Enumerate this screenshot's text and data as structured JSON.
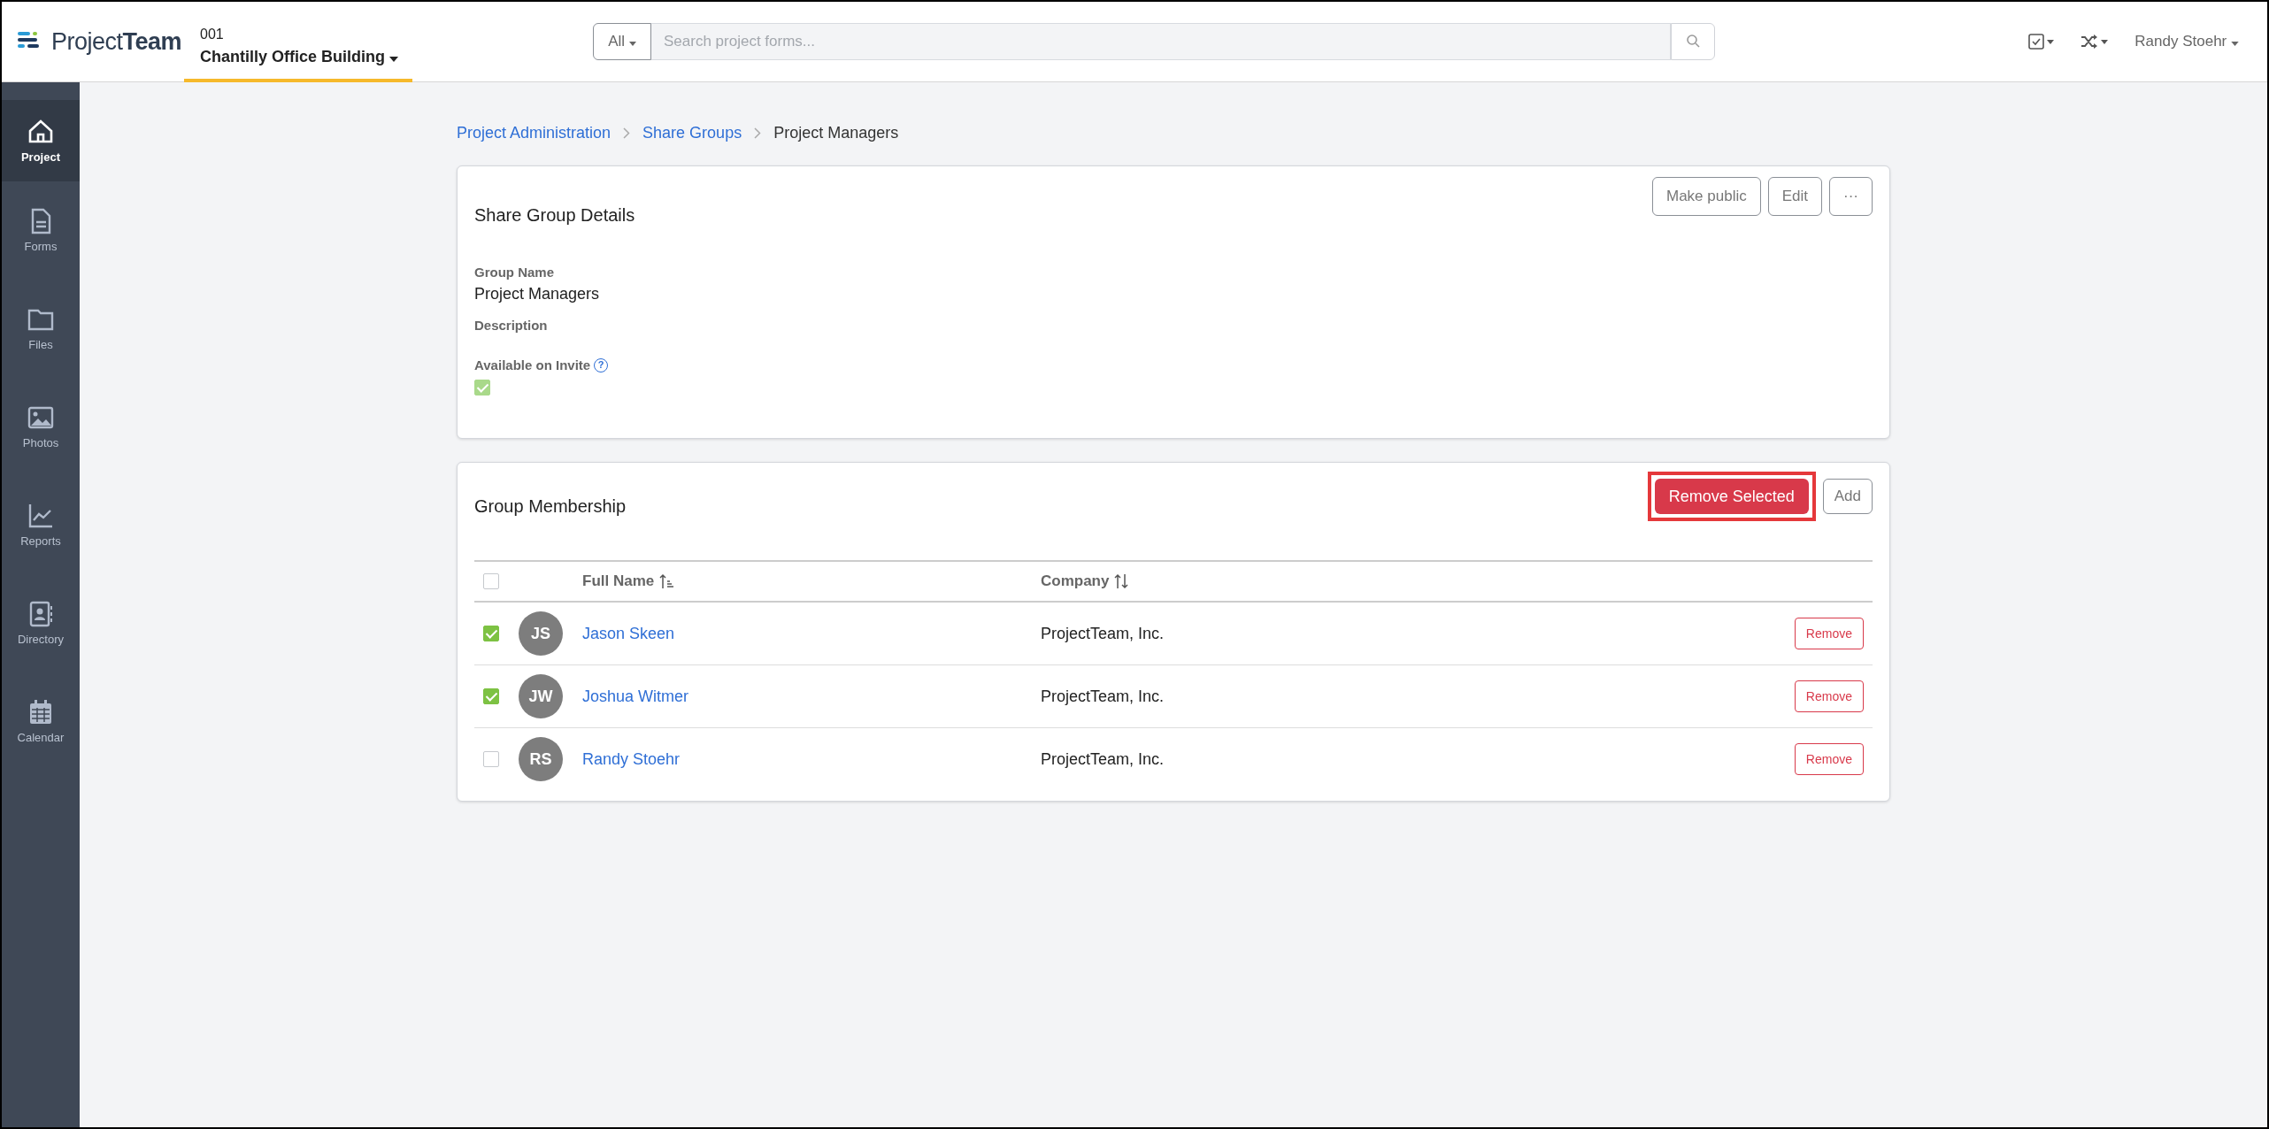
{
  "header": {
    "logo": "Project**Team**",
    "project": {
      "number": "001",
      "name": "Chantilly Office Building"
    },
    "search": {
      "scope": "All",
      "placeholder": "Search project forms..."
    },
    "user": "Randy Stoehr"
  },
  "sidebar": {
    "items": [
      {
        "label": "Project",
        "selected": true
      },
      {
        "label": "Forms",
        "selected": false
      },
      {
        "label": "Files",
        "selected": false
      },
      {
        "label": "Photos",
        "selected": false
      },
      {
        "label": "Reports",
        "selected": false
      },
      {
        "label": "Directory",
        "selected": false
      },
      {
        "label": "Calendar",
        "selected": false
      }
    ]
  },
  "breadcrumb": [
    {
      "label": "Project Administration",
      "current": false
    },
    {
      "label": "Share Groups",
      "current": false
    },
    {
      "label": "Project Managers",
      "current": true
    }
  ],
  "details": {
    "title": "Share Group Details",
    "buttons": [
      "Make public",
      "Edit",
      "···"
    ],
    "fields": [
      {
        "label": "Group Name",
        "value": "Project Managers"
      },
      {
        "label": "Description"
      }
    ],
    "available": {
      "label": "Available on Invite",
      "help": "?",
      "checked": true
    }
  },
  "membership": {
    "title": "Group Membership",
    "remove_selected": {
      "label": "Remove Selected",
      "highlighted": true
    },
    "add": "Add",
    "select_all": {
      "checked": false
    },
    "columns": [
      "Full Name",
      "Company"
    ],
    "rows": [
      {
        "initials": "JS",
        "name": "Jason Skeen",
        "company": "ProjectTeam, Inc.",
        "checked": true,
        "action": "Remove"
      },
      {
        "initials": "JW",
        "name": "Joshua Witmer",
        "company": "ProjectTeam, Inc.",
        "checked": true,
        "action": "Remove"
      },
      {
        "initials": "RS",
        "name": "Randy Stoehr",
        "company": "ProjectTeam, Inc.",
        "checked": false,
        "action": "Remove"
      }
    ]
  }
}
